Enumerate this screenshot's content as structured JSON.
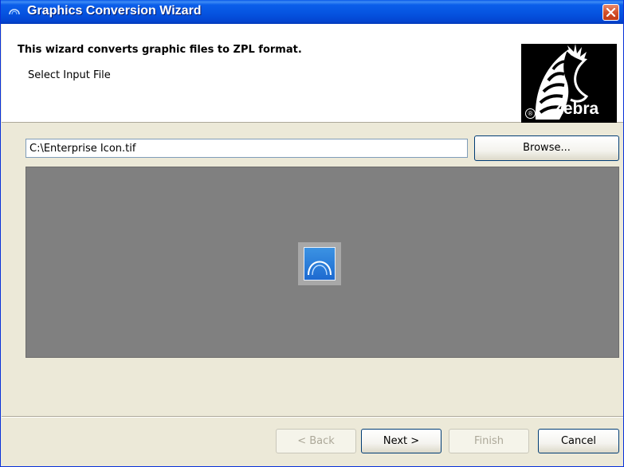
{
  "window": {
    "title": "Graphics Conversion Wizard"
  },
  "header": {
    "title": "This wizard converts graphic files to ZPL format.",
    "subtitle": "Select Input File",
    "logo_text": "Zebra",
    "logo_registered": "®"
  },
  "file": {
    "path": "C:\\Enterprise Icon.tif",
    "browse_label": "Browse..."
  },
  "preview": {
    "image": "enterprise-icon"
  },
  "footer": {
    "back_label": "< Back",
    "next_label": "Next >",
    "finish_label": "Finish",
    "cancel_label": "Cancel"
  },
  "colors": {
    "titlebar": "#0552df",
    "dialog_background": "#ece9d8",
    "preview_background": "#808080",
    "close_button": "#d4512a"
  }
}
